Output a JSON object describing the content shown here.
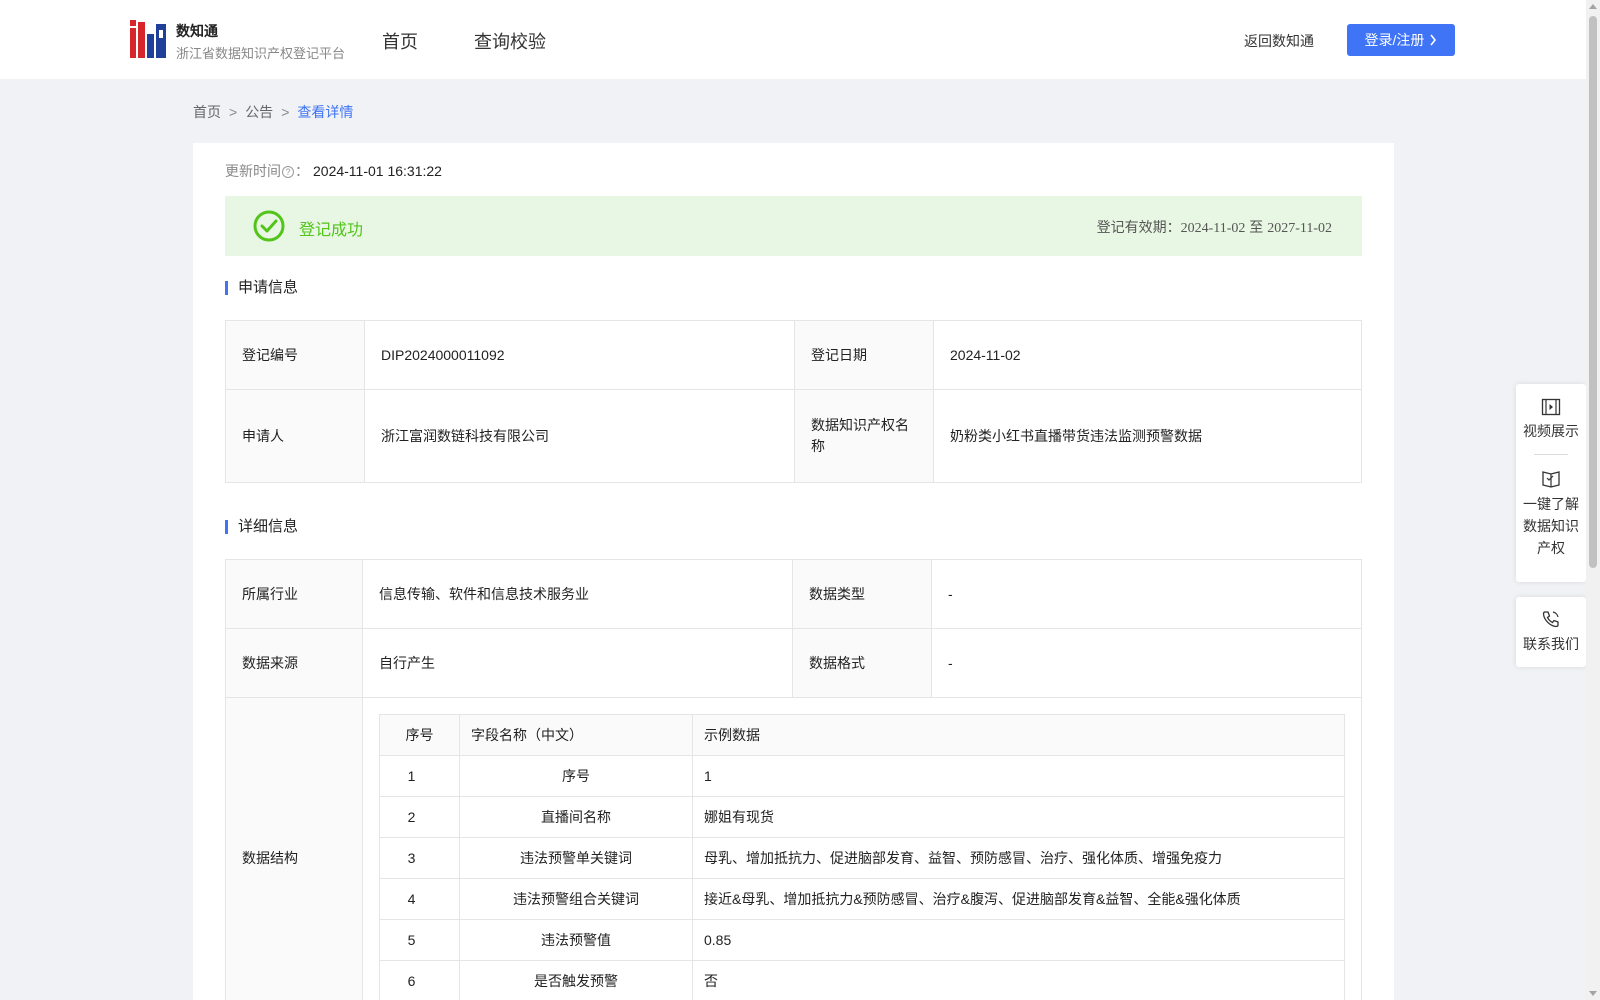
{
  "header": {
    "brand_name": "数知通",
    "brand_sub": "浙江省数据知识产权登记平台",
    "nav": {
      "home": "首页",
      "query": "查询校验"
    },
    "back_link": "返回数知通",
    "login_label": "登录/注册"
  },
  "breadcrumb": {
    "home": "首页",
    "notice": "公告",
    "current": "查看详情",
    "separator": ">"
  },
  "detail": {
    "update_label": "更新时间",
    "update_value": "2024-11-01 16:31:22",
    "status": "登记成功",
    "valid_label": "登记有效期：",
    "valid_start": "2024-11-02",
    "valid_to": " 至 ",
    "valid_end": "2027-11-02"
  },
  "apply_info": {
    "title": "申请信息",
    "reg_no_label": "登记编号",
    "reg_no": "DIP2024000011092",
    "reg_date_label": "登记日期",
    "reg_date": "2024-11-02",
    "applicant_label": "申请人",
    "applicant": "浙江富润数链科技有限公司",
    "ip_name_label": "数据知识产权名称",
    "ip_name": "奶粉类小红书直播带货违法监测预警数据"
  },
  "detail_info": {
    "title": "详细信息",
    "industry_label": "所属行业",
    "industry": "信息传输、软件和信息技术服务业",
    "data_type_label": "数据类型",
    "data_type": "-",
    "source_label": "数据来源",
    "source": "自行产生",
    "format_label": "数据格式",
    "format": "-",
    "structure_label": "数据结构"
  },
  "structure_table": {
    "headers": {
      "no": "序号",
      "name": "字段名称（中文）",
      "example": "示例数据"
    },
    "rows": [
      {
        "no": "1",
        "name": "序号",
        "example": "1"
      },
      {
        "no": "2",
        "name": "直播间名称",
        "example": "娜姐有现货"
      },
      {
        "no": "3",
        "name": "违法预警单关键词",
        "example": "母乳、增加抵抗力、促进脑部发育、益智、预防感冒、治疗、强化体质、增强免疫力"
      },
      {
        "no": "4",
        "name": "违法预警组合关键词",
        "example": "接近&母乳、增加抵抗力&预防感冒、治疗&腹泻、促进脑部发育&益智、全能&强化体质"
      },
      {
        "no": "5",
        "name": "违法预警值",
        "example": "0.85"
      },
      {
        "no": "6",
        "name": "是否触发预警",
        "example": "否"
      }
    ]
  },
  "sidebar": {
    "video": "视频展示",
    "know": "一键了解\n数据知识\n产权",
    "contact": "联系我们"
  },
  "colors": {
    "accent": "#3e74f5",
    "success": "#52c41a",
    "success_bg": "#e8f7e3",
    "page_bg": "#f0f2f5"
  },
  "icons": [
    "logo-icon",
    "question-circle-icon",
    "check-circle-icon",
    "chevron-right-icon",
    "video-icon",
    "book-icon",
    "phone-icon"
  ]
}
